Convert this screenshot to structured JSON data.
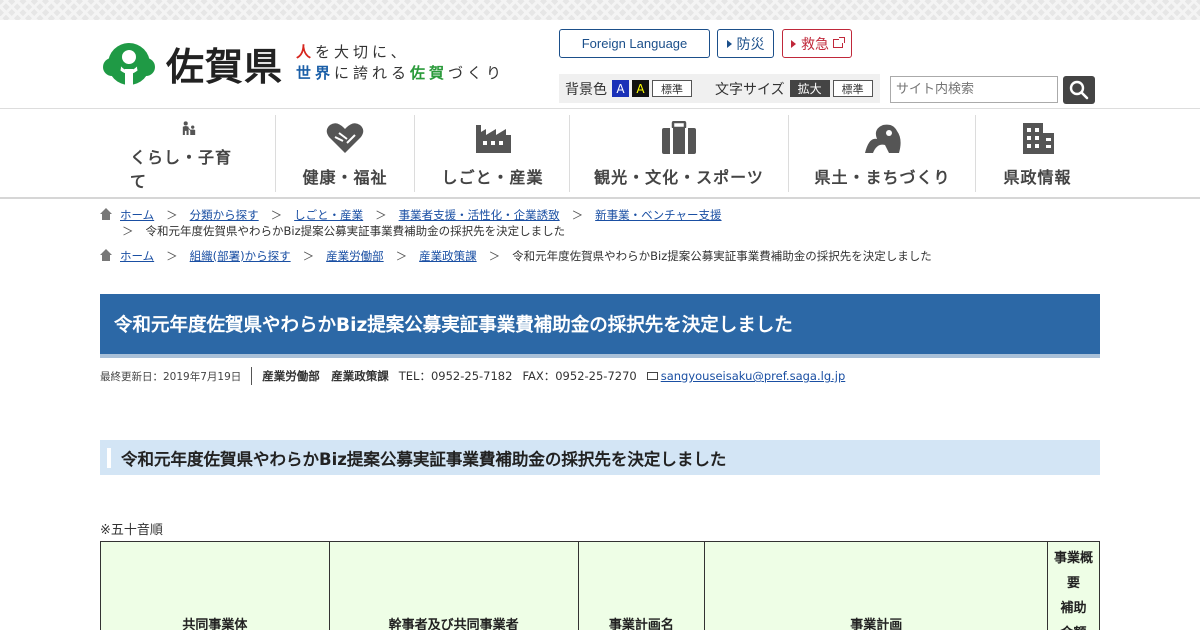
{
  "header": {
    "logo_text": "佐賀県",
    "tagline_line1": [
      "人",
      "を大切に、"
    ],
    "tagline_line2": [
      "世界",
      "に誇れる",
      "佐賀",
      "づくり"
    ],
    "foreign_language": "Foreign Language",
    "bousai": "防災",
    "kyukyu": "救急",
    "bg_color_label": "背景色",
    "bg_blue": "A",
    "bg_black": "A",
    "bg_standard": "標準",
    "font_size_label": "文字サイズ",
    "font_large": "拡大",
    "font_standard": "標準",
    "search_placeholder": "サイト内検索"
  },
  "nav": {
    "items": [
      {
        "label": "くらし・子育て",
        "icon": "family-icon"
      },
      {
        "label": "健康・福祉",
        "icon": "heart-hands-icon"
      },
      {
        "label": "しごと・産業",
        "icon": "factory-icon"
      },
      {
        "label": "観光・文化・スポーツ",
        "icon": "suitcase-icon"
      },
      {
        "label": "県土・まちづくり",
        "icon": "landscape-icon"
      },
      {
        "label": "県政情報",
        "icon": "building-icon"
      }
    ]
  },
  "breadcrumbs": {
    "trail1": [
      "ホーム",
      "分類から探す",
      "しごと・産業",
      "事業者支援・活性化・企業誘致",
      "新事業・ベンチャー支援"
    ],
    "trail1_current": "令和元年度佐賀県やわらかBiz提案公募実証事業費補助金の採択先を決定しました",
    "trail2": [
      "ホーム",
      "組織(部署)から探す",
      "産業労働部",
      "産業政策課"
    ],
    "trail2_current": "令和元年度佐賀県やわらかBiz提案公募実証事業費補助金の採択先を決定しました",
    "separator": "＞"
  },
  "page": {
    "title": "令和元年度佐賀県やわらかBiz提案公募実証事業費補助金の採択先を決定しました",
    "updated": "最終更新日：2019年7月19日",
    "dept": "産業労働部　産業政策課",
    "tel": "TEL：0952-25-7182",
    "fax": "FAX：0952-25-7270",
    "email": "sangyouseisaku@pref.saga.lg.jp",
    "heading": "令和元年度佐賀県やわらかBiz提案公募実証事業費補助金の採択先を決定しました",
    "note": "※五十音順"
  },
  "table": {
    "headers": [
      "共同事業体",
      "幹事者及び共同事業者",
      "事業計画名",
      "事業計画"
    ],
    "last_header": [
      "事業概",
      "要",
      "補助",
      "金額"
    ]
  },
  "colors": {
    "title_bar": "#2c68a6",
    "heading_bar": "#d3e5f5",
    "table_header": "#eefee6",
    "logo_green": "#1f9a45"
  }
}
